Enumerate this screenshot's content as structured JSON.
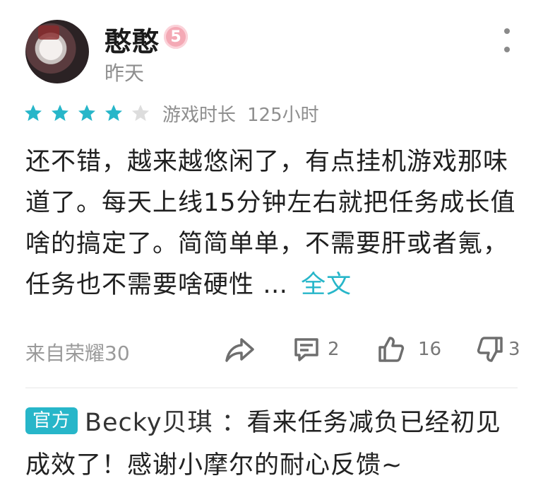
{
  "author": {
    "name": "憨憨",
    "level": "5",
    "time": "昨天"
  },
  "rating": {
    "stars_filled": 4,
    "stars_total": 5,
    "star_color": "#27b6c9",
    "star_empty_color": "#dddddd",
    "playtime_label": "游戏时长",
    "playtime_value": "125小时"
  },
  "review": {
    "text": "还不错，越来越悠闲了，有点挂机游戏那味道了。每天上线15分钟左右就把任务成长值啥的搞定了。简简单单，不需要肝或者氪，任务也不需要啥硬性 …",
    "full_link": "全文"
  },
  "footer": {
    "device": "来自荣耀30",
    "comment_count": "2",
    "like_count": "16",
    "dislike_count": "3"
  },
  "official_reply": {
    "tag": "官方",
    "author": "Becky贝琪 ：",
    "text": "看来任务减负已经初见成效了！感谢小摩尔的耐心反馈~"
  },
  "colors": {
    "accent": "#27b6c9",
    "level_badge": "#f4a9b5"
  }
}
